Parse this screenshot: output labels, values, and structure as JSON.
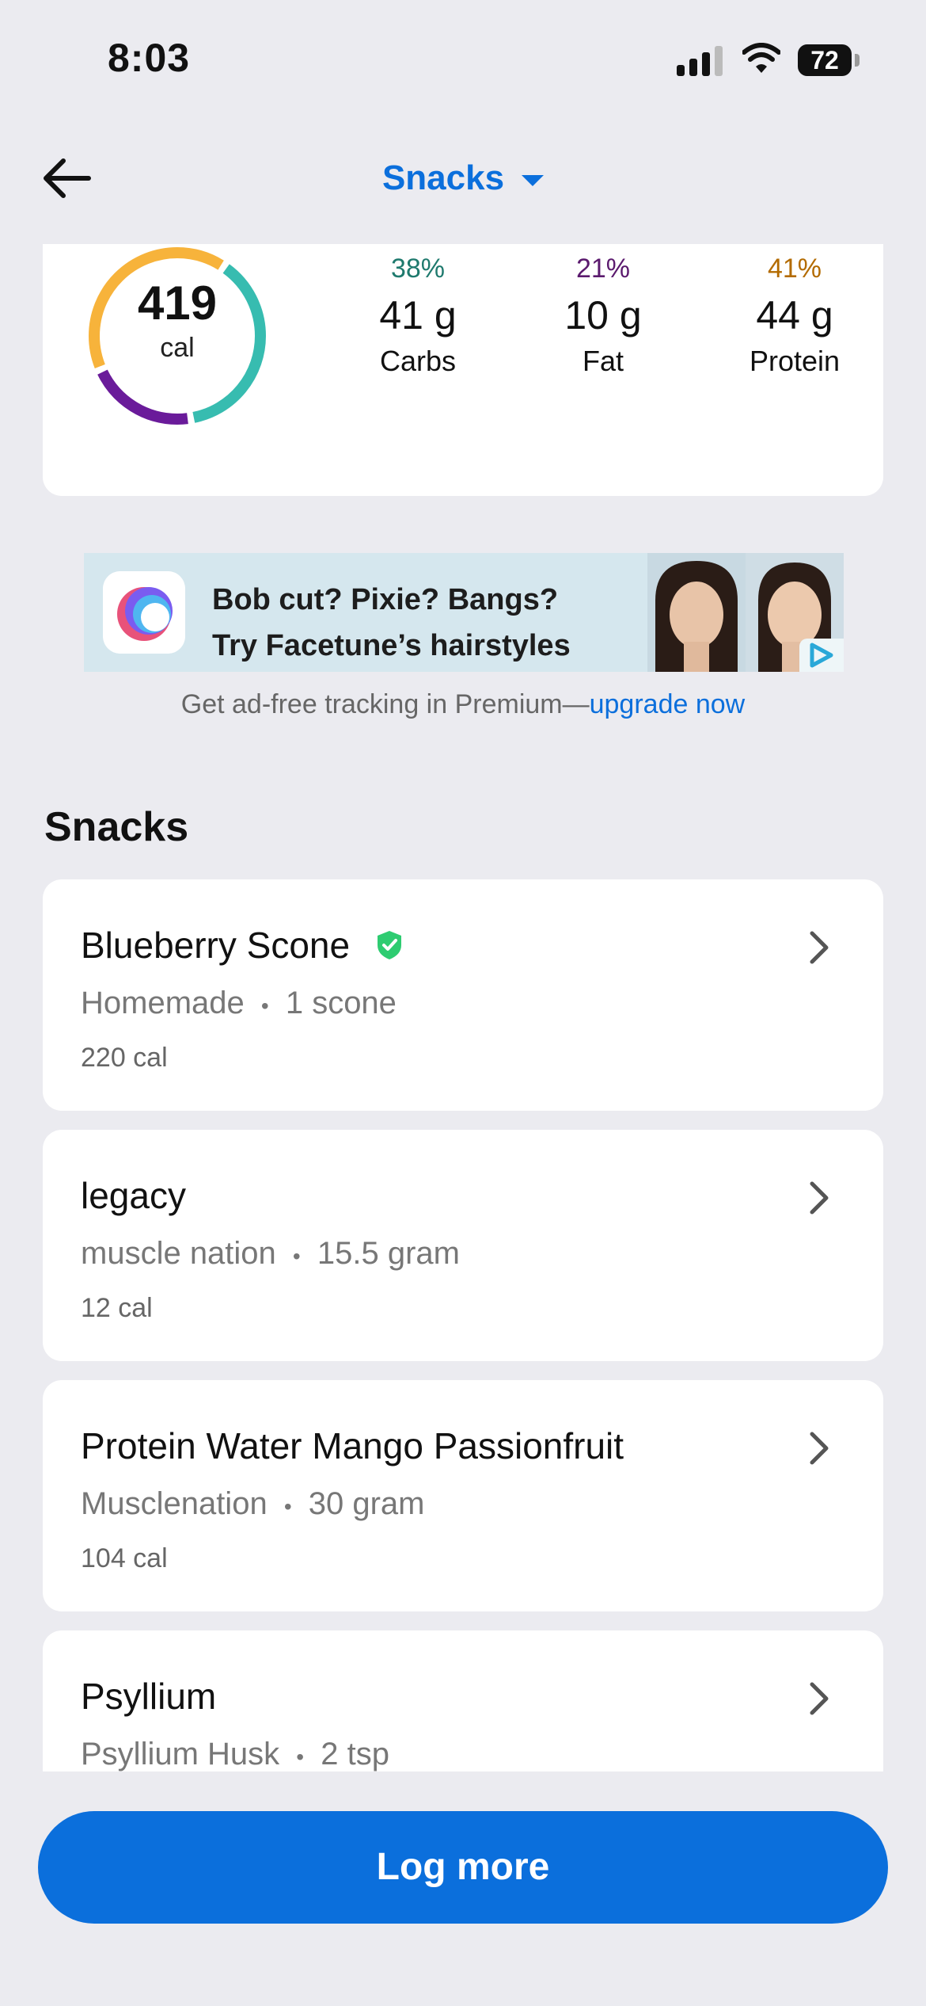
{
  "status_bar": {
    "time": "8:03",
    "battery": "72"
  },
  "nav": {
    "title": "Snacks"
  },
  "summary": {
    "calories": "419",
    "calories_unit": "cal",
    "ring_colors": {
      "carbs": "#37bcb0",
      "fat": "#6a1b9a",
      "protein": "#f7b33b"
    },
    "macros": [
      {
        "percent": "38%",
        "grams": "41 g",
        "label": "Carbs",
        "color": "#1f7a6e"
      },
      {
        "percent": "21%",
        "grams": "10 g",
        "label": "Fat",
        "color": "#5b1a6e"
      },
      {
        "percent": "41%",
        "grams": "44 g",
        "label": "Protein",
        "color": "#b36b00"
      }
    ]
  },
  "ad": {
    "line1": "Bob cut? Pixie? Bangs?",
    "line2": "Try Facetune’s hairstyles",
    "note_prefix": "Get ad-free tracking in Premium—",
    "note_link": "upgrade now"
  },
  "section": {
    "title": "Snacks"
  },
  "foods": [
    {
      "name": "Blueberry Scone",
      "verified": true,
      "brand": "Homemade",
      "serving": "1 scone",
      "calories": "220 cal"
    },
    {
      "name": "legacy",
      "verified": false,
      "brand": "muscle nation",
      "serving": "15.5 gram",
      "calories": "12 cal"
    },
    {
      "name": "Protein Water Mango Passionfruit",
      "verified": false,
      "brand": "Musclenation",
      "serving": "30 gram",
      "calories": "104 cal"
    },
    {
      "name": "Psyllium",
      "verified": false,
      "brand": "Psyllium Husk",
      "serving": "2 tsp",
      "calories": ""
    }
  ],
  "separator": "•",
  "footer": {
    "button_label": "Log more"
  },
  "colors": {
    "accent": "#0b6fdc",
    "verified": "#2ecc71"
  }
}
